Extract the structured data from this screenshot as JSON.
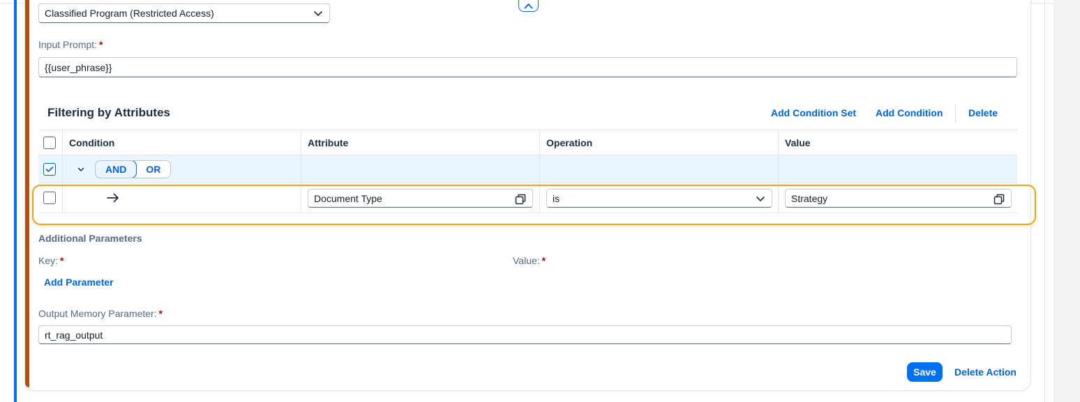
{
  "program_select": {
    "value": "Classified Program (Restricted Access)"
  },
  "input_prompt": {
    "label": "Input Prompt:",
    "required": "*",
    "value": "{{user_phrase}}"
  },
  "filtering": {
    "title": "Filtering by Attributes",
    "actions": {
      "add_condition_set": "Add Condition Set",
      "add_condition": "Add Condition",
      "delete": "Delete"
    },
    "columns": {
      "condition": "Condition",
      "attribute": "Attribute",
      "operation": "Operation",
      "value": "Value"
    },
    "group": {
      "and": "AND",
      "or": "OR",
      "selected": "AND"
    },
    "rows": [
      {
        "attribute": "Document Type",
        "operation": "is",
        "value": "Strategy"
      }
    ]
  },
  "additional_params": {
    "title": "Additional Parameters",
    "key_label": "Key:",
    "value_label": "Value:",
    "required": "*",
    "add_parameter": "Add Parameter"
  },
  "output_memory": {
    "label": "Output Memory Parameter:",
    "required": "*",
    "value": "rt_rag_output"
  },
  "footer": {
    "save": "Save",
    "delete_action": "Delete Action"
  },
  "colors": {
    "accent": "#0070f2",
    "link": "#0064d9",
    "card_stripe": "#b44f14",
    "highlight": "#e8a317",
    "required": "#aa0808"
  }
}
